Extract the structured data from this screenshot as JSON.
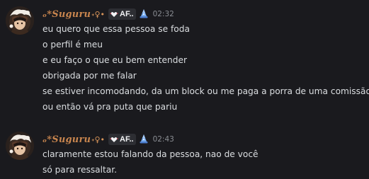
{
  "messages": [
    {
      "username": "ₒ*Suguru",
      "username_deco": "˖♀•",
      "tag_label": "AF..",
      "timestamp": "02:32",
      "lines": [
        "eu quero que essa pessoa se foda",
        "o perfil é meu",
        "e eu faço o que eu bem entender",
        "obrigada por me falar",
        "se estiver incomodando, da um block ou me paga a porra de uma comissão",
        "ou então vá pra puta que pariu"
      ]
    },
    {
      "username": "ₒ*Suguru",
      "username_deco": "˖♀•",
      "tag_label": "AF..",
      "timestamp": "02:43",
      "lines": [
        "claramente estou falando da pessoa, nao de você",
        "só para ressaltar."
      ]
    }
  ],
  "colors": {
    "background": "#1a1a1e",
    "username": "#c8854e",
    "message_text": "#dbdee1",
    "timestamp": "#8a8d93",
    "tag_bg": "#2d2e33",
    "badge": "#5b8fd9"
  },
  "icons": {
    "tag_icon": "heart-wings-icon",
    "badge_icon": "wizard-hat-icon",
    "avatar": "anime-character-avatar"
  }
}
